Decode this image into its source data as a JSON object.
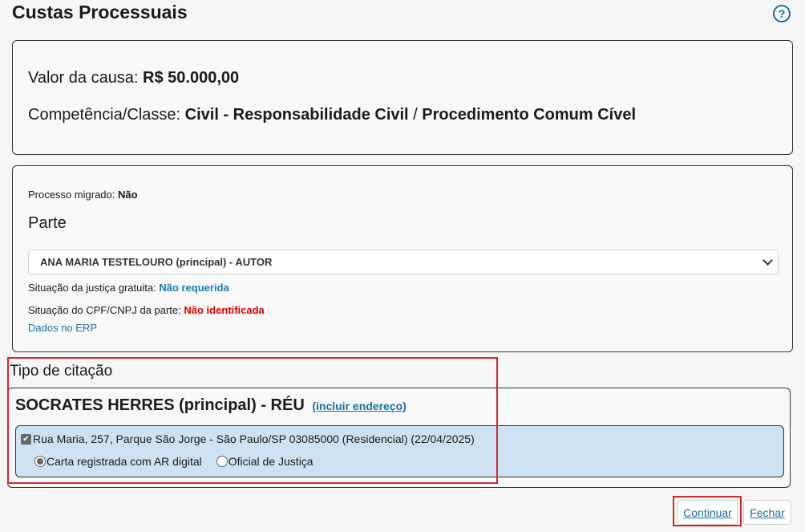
{
  "page": {
    "title": "Custas Processuais"
  },
  "help": {
    "glyph": "?"
  },
  "causa": {
    "valor_label": "Valor da causa: ",
    "valor": "R$ 50.000,00",
    "competencia_label": "Competência/Classe: ",
    "competencia_civil": "Civil - Responsabilidade Civil",
    "competencia_sep": " / ",
    "competencia_proc": "Procedimento Comum Cível"
  },
  "processo": {
    "migrado_label": "Processo migrado: ",
    "migrado_value": "Não",
    "parte_label": "Parte",
    "parte_selected": "ANA MARIA TESTELOURO (principal) - AUTOR",
    "justica_label": "Situação da justiça gratuita: ",
    "justica_value": "Não requerida",
    "cpf_label": "Situação do CPF/CNPJ da parte: ",
    "cpf_value": "Não identificada",
    "erp_link": "Dados no ERP",
    "colors": {
      "blue": "#1a7ab8",
      "red": "#e00000"
    }
  },
  "citacao": {
    "heading": "Tipo de citação",
    "reu": "SOCRATES HERRES (principal) - RÉU",
    "incluir_link": "(incluir endereço)",
    "endereco": "Rua Maria, 257, Parque São Jorge - São Paulo/SP 03085000 (Residencial) (22/04/2025)",
    "endereco_checked": true,
    "opcoes": [
      {
        "label": "Carta registrada com AR digital",
        "selected": true
      },
      {
        "label": "Oficial de Justiça",
        "selected": false
      }
    ]
  },
  "buttons": {
    "continuar": "Continuar",
    "fechar": "Fechar"
  },
  "highlight_color": "#d9262c"
}
